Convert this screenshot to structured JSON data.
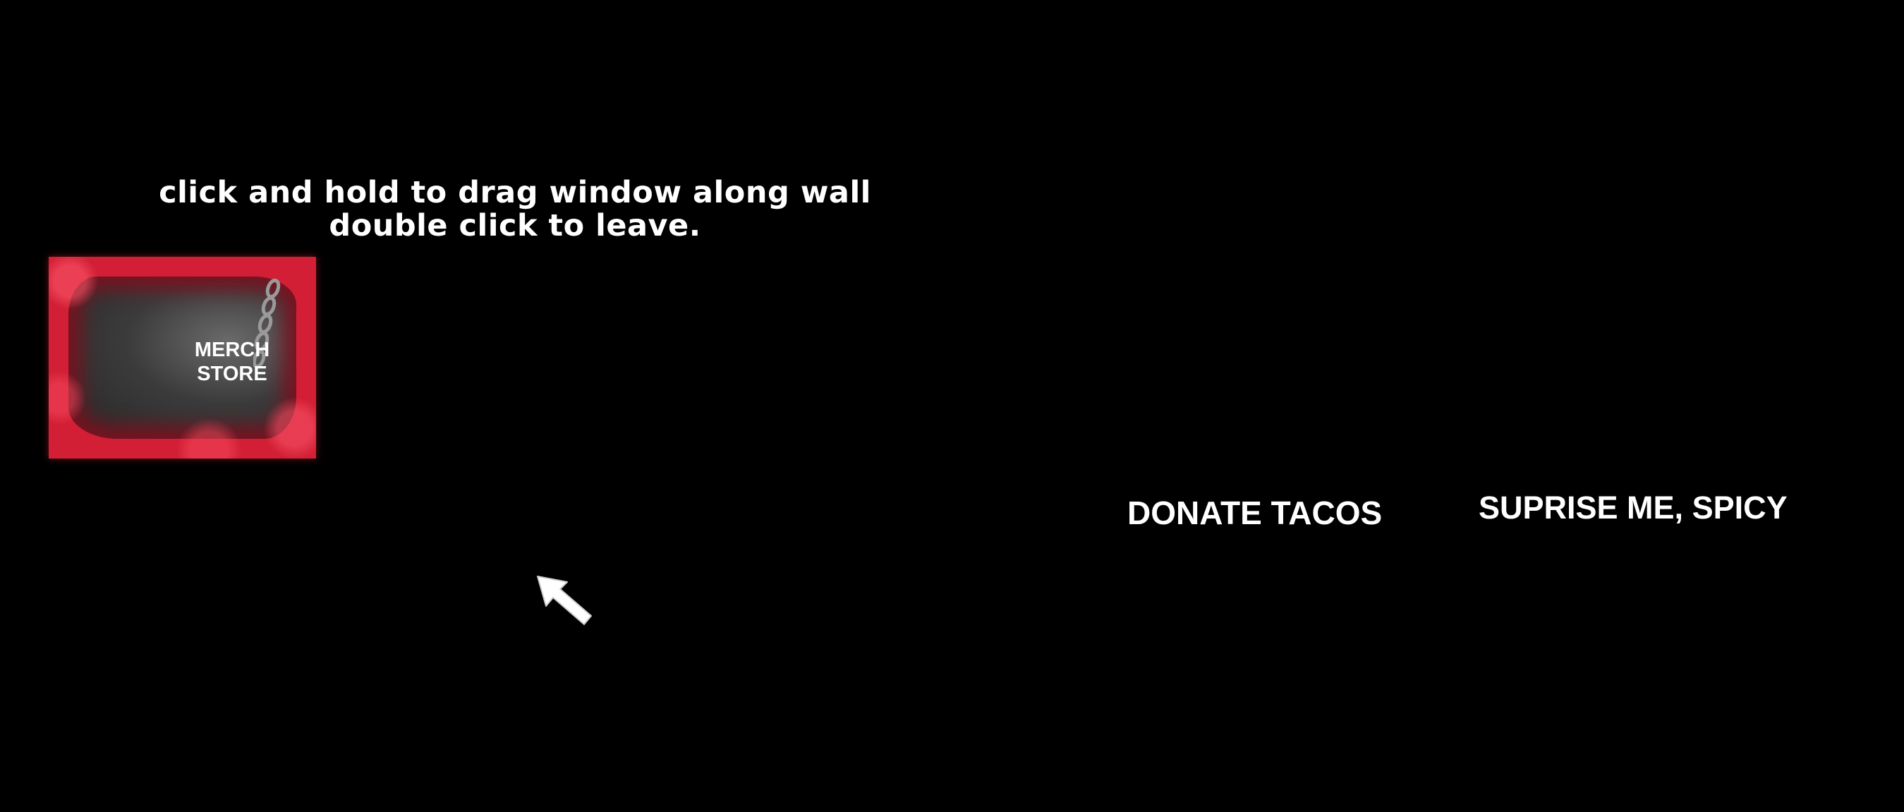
{
  "instructions": {
    "line1": "click and hold to drag window along wall",
    "line2": "double click to leave."
  },
  "merch_store": {
    "line1": "MERCH",
    "line2": "STORE",
    "border_color": "#d21f35"
  },
  "links": {
    "donate": "DONATE TACOS",
    "surprise": "SUPRISE ME, SPICY"
  },
  "icons": {
    "cursor": "arrow-cursor-icon",
    "chain": "chain-icon"
  },
  "colors": {
    "background": "#000000",
    "text": "#ffffff",
    "accent": "#d21f35"
  }
}
